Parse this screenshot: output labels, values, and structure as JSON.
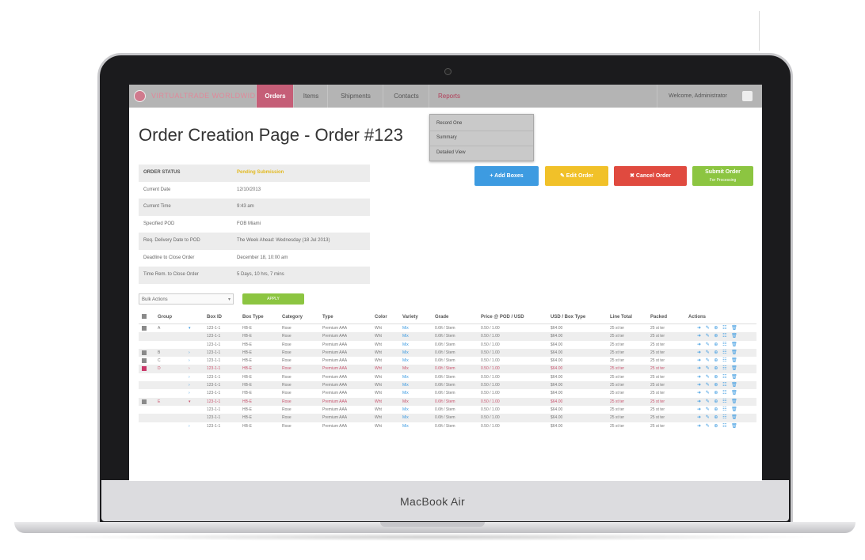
{
  "device": {
    "brand_label": "MacBook Air"
  },
  "navbar": {
    "brand": "VIRTUALTRADE WORLDWIDE",
    "tabs": [
      {
        "label": "Orders",
        "active": true
      },
      {
        "label": "Items",
        "active": false
      },
      {
        "label": "Shipments",
        "active": false
      },
      {
        "label": "Contacts",
        "active": false
      },
      {
        "label": "Reports",
        "active": false
      }
    ],
    "welcome": "Welcome, Administrator",
    "reports_menu": [
      "Record One",
      "Summary",
      "Detailed View"
    ]
  },
  "page": {
    "title": "Order Creation Page - Order #123"
  },
  "order_info": [
    {
      "key": "ORDER STATUS",
      "value": "Pending Submission"
    },
    {
      "key": "Current Date",
      "value": "12/10/2013"
    },
    {
      "key": "Current Time",
      "value": "9:43 am"
    },
    {
      "key": "Specified POD",
      "value": "FOB Miami"
    },
    {
      "key": "Req. Delivery Date to POD",
      "value": "The Week Ahead: Wednesday (18 Jul 2013)"
    },
    {
      "key": "Deadline to Close Order",
      "value": "December 18, 10:00 am"
    },
    {
      "key": "Time Rem. to Close Order",
      "value": "5 Days, 10 hrs, 7 mins"
    }
  ],
  "actions": {
    "add_boxes": "+ Add Boxes",
    "edit_order": "Edit Order",
    "cancel_order": "Cancel Order",
    "submit_order": "Submit Order",
    "submit_sub": "For Processing"
  },
  "bulk": {
    "placeholder": "Bulk Actions",
    "apply": "APPLY"
  },
  "table": {
    "headers": [
      "Group",
      "Box ID",
      "Box Type",
      "Category",
      "Type",
      "Color",
      "Variety",
      "Grade",
      "Price @ POD / USD",
      "USD / Box Type",
      "Line Total",
      "Packed",
      "Actions"
    ],
    "rows": [
      {
        "cb": "grey",
        "group": "A",
        "chev": "▾",
        "box": "123-1-1",
        "btype": "HB-E",
        "cat": "Rose",
        "type": "Premium AAA",
        "color": "Wht",
        "variety": "Mix",
        "grade": "0.6ft / Stem",
        "price": "0.50 / 1.00",
        "usd": "$64.00",
        "total": "25 st ter",
        "packed": "25 st ter",
        "style": ""
      },
      {
        "cb": "",
        "group": "",
        "chev": "",
        "box": "123-1-1",
        "btype": "HB-E",
        "cat": "Rose",
        "type": "Premium AAA",
        "color": "Wht",
        "variety": "Mix",
        "grade": "0.6ft / Stem",
        "price": "0.50 / 1.00",
        "usd": "$64.00",
        "total": "25 st ter",
        "packed": "25 st ter",
        "style": ""
      },
      {
        "cb": "",
        "group": "",
        "chev": "",
        "box": "123-1-1",
        "btype": "HB-E",
        "cat": "Rose",
        "type": "Premium AAA",
        "color": "Wht",
        "variety": "Mix",
        "grade": "0.6ft / Stem",
        "price": "0.50 / 1.00",
        "usd": "$64.00",
        "total": "25 st ter",
        "packed": "25 st ter",
        "style": ""
      },
      {
        "cb": "grey",
        "group": "B",
        "chev": "›",
        "box": "123-1-1",
        "btype": "HB-E",
        "cat": "Rose",
        "type": "Premium AAA",
        "color": "Wht",
        "variety": "Mix",
        "grade": "0.6ft / Stem",
        "price": "0.50 / 1.00",
        "usd": "$64.00",
        "total": "25 st ter",
        "packed": "25 st ter",
        "style": ""
      },
      {
        "cb": "grey",
        "group": "C",
        "chev": "›",
        "box": "123-1-1",
        "btype": "HB-E",
        "cat": "Rose",
        "type": "Premium AAA",
        "color": "Wht",
        "variety": "Mix",
        "grade": "0.6ft / Stem",
        "price": "0.50 / 1.00",
        "usd": "$64.00",
        "total": "25 st ter",
        "packed": "25 st ter",
        "style": ""
      },
      {
        "cb": "pink",
        "group": "D",
        "chev": "›",
        "box": "123-1-1",
        "btype": "HB-E",
        "cat": "Rose",
        "type": "Premium AAA",
        "color": "Wht",
        "variety": "Mix",
        "grade": "0.6ft / Stem",
        "price": "0.50 / 1.00",
        "usd": "$64.00",
        "total": "25 st ter",
        "packed": "25 st ter",
        "style": "pink"
      },
      {
        "cb": "",
        "group": "",
        "chev": "›",
        "box": "123-1-1",
        "btype": "HB-E",
        "cat": "Rose",
        "type": "Premium AAA",
        "color": "Wht",
        "variety": "Mix",
        "grade": "0.6ft / Stem",
        "price": "0.50 / 1.00",
        "usd": "$64.00",
        "total": "25 st ter",
        "packed": "25 st ter",
        "style": ""
      },
      {
        "cb": "",
        "group": "",
        "chev": "›",
        "box": "123-1-1",
        "btype": "HB-E",
        "cat": "Rose",
        "type": "Premium AAA",
        "color": "Wht",
        "variety": "Mix",
        "grade": "0.6ft / Stem",
        "price": "0.50 / 1.00",
        "usd": "$64.00",
        "total": "25 st ter",
        "packed": "25 st ter",
        "style": ""
      },
      {
        "cb": "",
        "group": "",
        "chev": "›",
        "box": "123-1-1",
        "btype": "HB-E",
        "cat": "Rose",
        "type": "Premium AAA",
        "color": "Wht",
        "variety": "Mix",
        "grade": "0.6ft / Stem",
        "price": "0.50 / 1.00",
        "usd": "$64.00",
        "total": "25 st ter",
        "packed": "25 st ter",
        "style": ""
      },
      {
        "cb": "grey",
        "group": "E",
        "chev": "▾",
        "box": "123-1-1",
        "btype": "HB-E",
        "cat": "Rose",
        "type": "Premium AAA",
        "color": "Wht",
        "variety": "Mix",
        "grade": "0.6ft / Stem",
        "price": "0.50 / 1.00",
        "usd": "$64.00",
        "total": "25 st ter",
        "packed": "25 st ter",
        "style": "pink"
      },
      {
        "cb": "",
        "group": "",
        "chev": "",
        "box": "123-1-1",
        "btype": "HB-E",
        "cat": "Rose",
        "type": "Premium AAA",
        "color": "Wht",
        "variety": "Mix",
        "grade": "0.6ft / Stem",
        "price": "0.50 / 1.00",
        "usd": "$64.00",
        "total": "25 st ter",
        "packed": "25 st ter",
        "style": ""
      },
      {
        "cb": "",
        "group": "",
        "chev": "",
        "box": "123-1-1",
        "btype": "HB-E",
        "cat": "Rose",
        "type": "Premium AAA",
        "color": "Wht",
        "variety": "Mix",
        "grade": "0.6ft / Stem",
        "price": "0.50 / 1.00",
        "usd": "$64.00",
        "total": "25 st ter",
        "packed": "25 st ter",
        "style": ""
      },
      {
        "cb": "",
        "group": "",
        "chev": "›",
        "box": "123-1-1",
        "btype": "HB-E",
        "cat": "Rose",
        "type": "Premium AAA",
        "color": "Wht",
        "variety": "Mix",
        "grade": "0.6ft / Stem",
        "price": "0.50 / 1.00",
        "usd": "$64.00",
        "total": "25 st ter",
        "packed": "25 st ter",
        "style": ""
      }
    ],
    "row_actions": "➜ ✎ ⊕ ☷ 🗑"
  },
  "colors": {
    "accent": "#c55e77",
    "blue": "#3d9be1",
    "yellow": "#f1c129",
    "red": "#e04a3f",
    "green": "#8cc541"
  }
}
